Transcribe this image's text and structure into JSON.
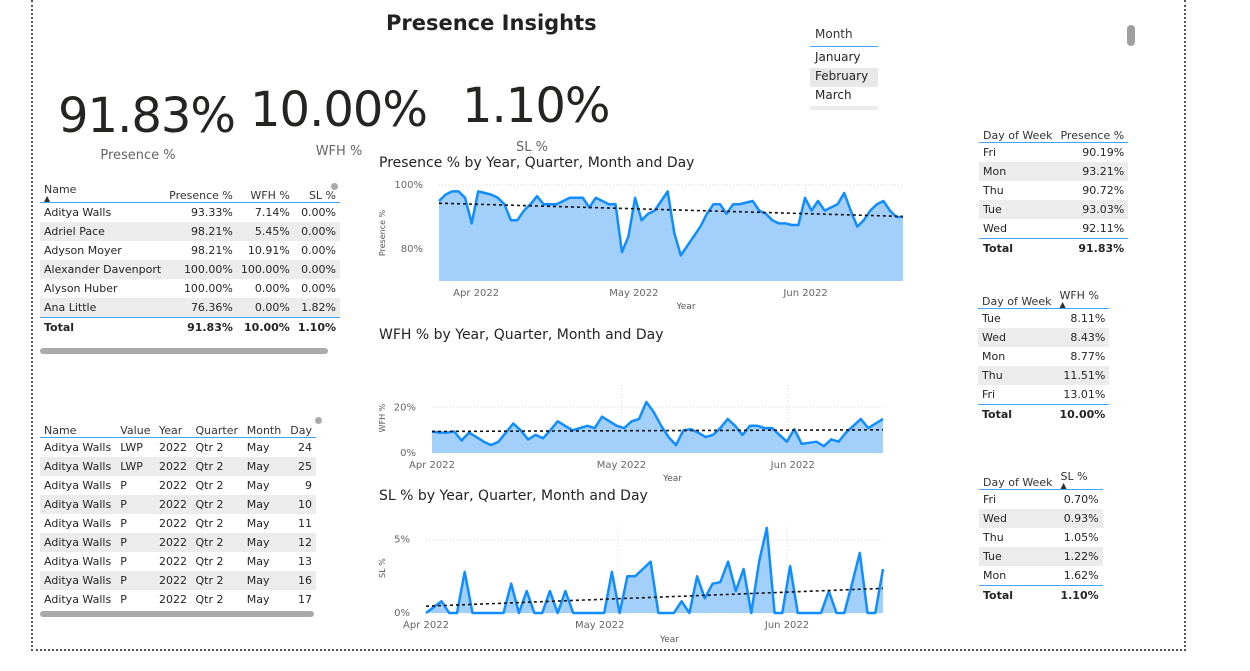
{
  "report_title": "Presence Insights",
  "kpis": {
    "presence": {
      "value": "91.83%",
      "label": "Presence %"
    },
    "wfh": {
      "value": "10.00%",
      "label": "WFH %"
    },
    "sl": {
      "value": "1.10%",
      "label": "SL %"
    }
  },
  "month_slicer": {
    "header": "Month",
    "options": [
      "January",
      "February",
      "March"
    ],
    "selected": "February"
  },
  "summary_table": {
    "columns": [
      "Name",
      "Presence %",
      "WFH %",
      "SL %"
    ],
    "rows": [
      [
        "Aditya Walls",
        "93.33%",
        "7.14%",
        "0.00%"
      ],
      [
        "Adriel Pace",
        "98.21%",
        "5.45%",
        "0.00%"
      ],
      [
        "Adyson Moyer",
        "98.21%",
        "10.91%",
        "0.00%"
      ],
      [
        "Alexander Davenport",
        "100.00%",
        "100.00%",
        "0.00%"
      ],
      [
        "Alyson Huber",
        "100.00%",
        "0.00%",
        "0.00%"
      ],
      [
        "Ana Little",
        "76.36%",
        "0.00%",
        "1.82%"
      ]
    ],
    "total": [
      "Total",
      "91.83%",
      "10.00%",
      "1.10%"
    ]
  },
  "detail_table": {
    "columns": [
      "Name",
      "Value",
      "Year",
      "Quarter",
      "Month",
      "Day"
    ],
    "rows": [
      [
        "Aditya Walls",
        "LWP",
        "2022",
        "Qtr 2",
        "May",
        "24"
      ],
      [
        "Aditya Walls",
        "LWP",
        "2022",
        "Qtr 2",
        "May",
        "25"
      ],
      [
        "Aditya Walls",
        "P",
        "2022",
        "Qtr 2",
        "May",
        "9"
      ],
      [
        "Aditya Walls",
        "P",
        "2022",
        "Qtr 2",
        "May",
        "10"
      ],
      [
        "Aditya Walls",
        "P",
        "2022",
        "Qtr 2",
        "May",
        "11"
      ],
      [
        "Aditya Walls",
        "P",
        "2022",
        "Qtr 2",
        "May",
        "12"
      ],
      [
        "Aditya Walls",
        "P",
        "2022",
        "Qtr 2",
        "May",
        "13"
      ],
      [
        "Aditya Walls",
        "P",
        "2022",
        "Qtr 2",
        "May",
        "16"
      ],
      [
        "Aditya Walls",
        "P",
        "2022",
        "Qtr 2",
        "May",
        "17"
      ]
    ]
  },
  "dow_presence": {
    "columns": [
      "Day of Week",
      "Presence %"
    ],
    "rows": [
      [
        "Fri",
        "90.19%"
      ],
      [
        "Mon",
        "93.21%"
      ],
      [
        "Thu",
        "90.72%"
      ],
      [
        "Tue",
        "93.03%"
      ],
      [
        "Wed",
        "92.11%"
      ]
    ],
    "total": [
      "Total",
      "91.83%"
    ]
  },
  "dow_wfh": {
    "columns": [
      "Day of Week",
      "WFH %"
    ],
    "rows": [
      [
        "Tue",
        "8.11%"
      ],
      [
        "Wed",
        "8.43%"
      ],
      [
        "Mon",
        "8.77%"
      ],
      [
        "Thu",
        "11.51%"
      ],
      [
        "Fri",
        "13.01%"
      ]
    ],
    "total": [
      "Total",
      "10.00%"
    ]
  },
  "dow_sl": {
    "columns": [
      "Day of Week",
      "SL %"
    ],
    "rows": [
      [
        "Fri",
        "0.70%"
      ],
      [
        "Wed",
        "0.93%"
      ],
      [
        "Thu",
        "1.05%"
      ],
      [
        "Tue",
        "1.22%"
      ],
      [
        "Mon",
        "1.62%"
      ]
    ],
    "total": [
      "Total",
      "1.10%"
    ]
  },
  "colors": {
    "accent": "#41a4ff",
    "line": "#118dff",
    "area": "#a3d0fb",
    "trend": "#000000"
  },
  "chart_data": [
    {
      "type": "area",
      "title": "Presence % by Year, Quarter, Month and Day",
      "xlabel": "Year",
      "ylabel": "Presence %",
      "x_ticks": [
        "Apr 2022",
        "May 2022",
        "Jun 2022"
      ],
      "y_ticks": [
        "80%",
        "100%"
      ],
      "ylim": [
        70,
        100
      ],
      "trend": true,
      "values": [
        95,
        97,
        98,
        98,
        96,
        88,
        98,
        97.5,
        97,
        96,
        94,
        89,
        89,
        92,
        94,
        96.5,
        94,
        94,
        94,
        95,
        96,
        96,
        96,
        93,
        96,
        95,
        94,
        94,
        79,
        84,
        96,
        89,
        91,
        92,
        95,
        98,
        85,
        78,
        81,
        84,
        87,
        91,
        94,
        94,
        91,
        94,
        94,
        94.5,
        95,
        92,
        91,
        89,
        88,
        88,
        87.5,
        87.5,
        96,
        92,
        95,
        92,
        93,
        94,
        97.5,
        92,
        87,
        89,
        92,
        94,
        95,
        92,
        90,
        90
      ]
    },
    {
      "type": "area",
      "title": "WFH % by Year, Quarter, Month and Day",
      "xlabel": "Year",
      "ylabel": "WFH %",
      "x_ticks": [
        "Apr 2022",
        "May 2022",
        "Jun 2022"
      ],
      "y_ticks": [
        "0%",
        "20%"
      ],
      "ylim": [
        0,
        30
      ],
      "trend": true,
      "values": [
        9.5,
        9,
        9,
        9.5,
        5.5,
        9,
        7,
        5,
        3.5,
        5,
        9,
        13,
        10,
        6,
        8,
        6.5,
        10,
        14,
        12,
        10,
        11,
        12,
        11,
        16,
        14,
        12,
        11,
        14,
        15,
        22.5,
        18,
        12,
        7,
        3.5,
        10,
        10.5,
        9,
        7,
        8,
        11,
        15,
        12,
        8,
        12,
        12,
        11,
        11,
        8,
        5,
        10.5,
        4,
        4.5,
        5,
        3,
        6,
        5,
        9,
        12,
        15,
        11,
        13,
        15
      ]
    },
    {
      "type": "area",
      "title": "SL % by Year, Quarter, Month and Day",
      "xlabel": "Year",
      "ylabel": "SL %",
      "x_ticks": [
        "Apr 2022",
        "May 2022",
        "Jun 2022"
      ],
      "y_ticks": [
        "0%",
        "5%"
      ],
      "ylim": [
        0,
        6
      ],
      "trend": true,
      "values": [
        0,
        0.4,
        0.8,
        0,
        0,
        2.8,
        0,
        0,
        0,
        0,
        0,
        2,
        0,
        1.5,
        0,
        0,
        1.5,
        0,
        1.5,
        0,
        0,
        0,
        0,
        0,
        2.8,
        0,
        2.5,
        2.5,
        3,
        3.5,
        0,
        0,
        0,
        0.8,
        0,
        2.5,
        1,
        2,
        2.1,
        3.5,
        1.5,
        3,
        0,
        3.5,
        5.8,
        0,
        0,
        3.2,
        0,
        0,
        0,
        0,
        1.5,
        0,
        0,
        2,
        4.1,
        0,
        0,
        3
      ]
    }
  ]
}
